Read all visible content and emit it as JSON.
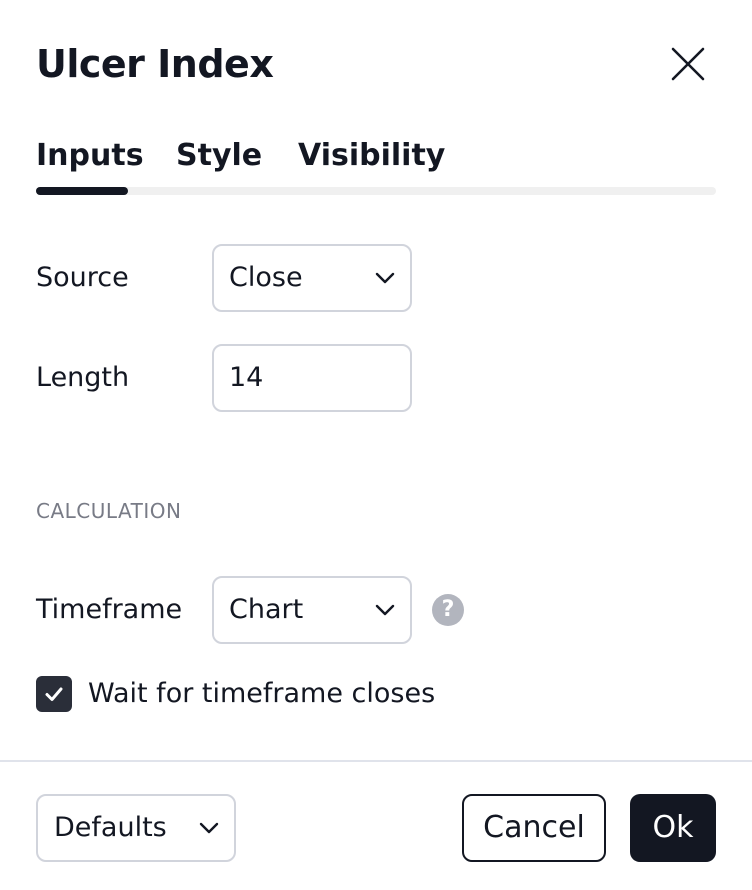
{
  "dialog": {
    "title": "Ulcer Index",
    "close_icon": "close-icon"
  },
  "tabs": [
    {
      "label": "Inputs",
      "active": true
    },
    {
      "label": "Style",
      "active": false
    },
    {
      "label": "Visibility",
      "active": false
    }
  ],
  "inputs": {
    "source": {
      "label": "Source",
      "value": "Close"
    },
    "length": {
      "label": "Length",
      "value": "14"
    }
  },
  "calculation": {
    "section_title": "CALCULATION",
    "timeframe": {
      "label": "Timeframe",
      "value": "Chart",
      "help_icon": "question-icon"
    },
    "wait_checkbox": {
      "label": "Wait for timeframe closes",
      "checked": true
    }
  },
  "footer": {
    "defaults_label": "Defaults",
    "cancel_label": "Cancel",
    "ok_label": "Ok"
  },
  "colors": {
    "text": "#131722",
    "muted": "#787b86",
    "border": "#d1d4dc",
    "checkbox": "#2a2e39",
    "primary_button": "#131722"
  }
}
